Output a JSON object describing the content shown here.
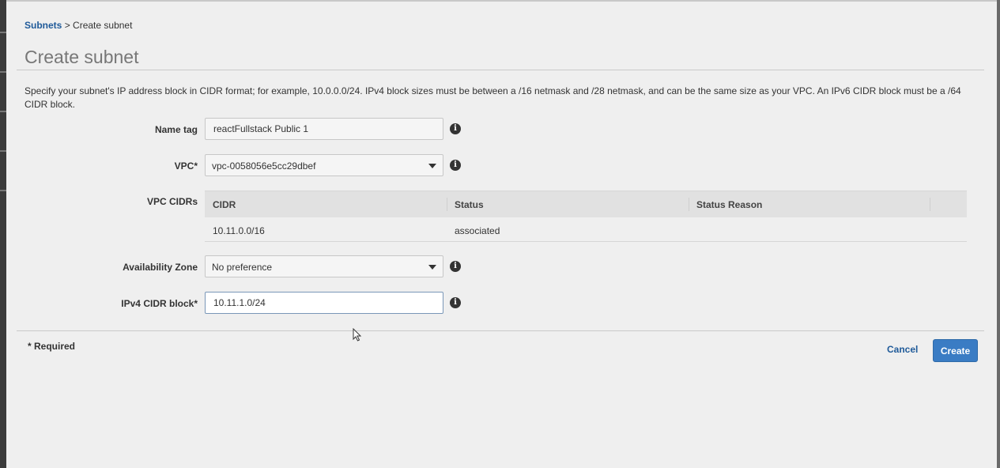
{
  "breadcrumb": {
    "parent": "Subnets",
    "separator": ">",
    "current": "Create subnet"
  },
  "page": {
    "title": "Create subnet",
    "description": "Specify your subnet's IP address block in CIDR format; for example, 10.0.0.0/24. IPv4 block sizes must be between a /16 netmask and /28 netmask, and can be the same size as your VPC. An IPv6 CIDR block must be a /64 CIDR block."
  },
  "form": {
    "name_tag": {
      "label": "Name tag",
      "value": "reactFullstack Public 1"
    },
    "vpc": {
      "label": "VPC*",
      "value": "vpc-0058056e5cc29dbef"
    },
    "vpc_cidrs": {
      "label": "VPC CIDRs",
      "columns": [
        "CIDR",
        "Status",
        "Status Reason"
      ],
      "rows": [
        {
          "cidr": "10.11.0.0/16",
          "status": "associated",
          "reason": ""
        }
      ]
    },
    "availability_zone": {
      "label": "Availability Zone",
      "value": "No preference"
    },
    "ipv4_cidr": {
      "label": "IPv4 CIDR block*",
      "value": "10.11.1.0/24"
    },
    "info_glyph": "i"
  },
  "footer": {
    "required_note": "* Required",
    "cancel_label": "Cancel",
    "create_label": "Create"
  },
  "colors": {
    "link": "#1f5a99",
    "primary_button": "#3a7cc4",
    "background": "#efefef"
  }
}
